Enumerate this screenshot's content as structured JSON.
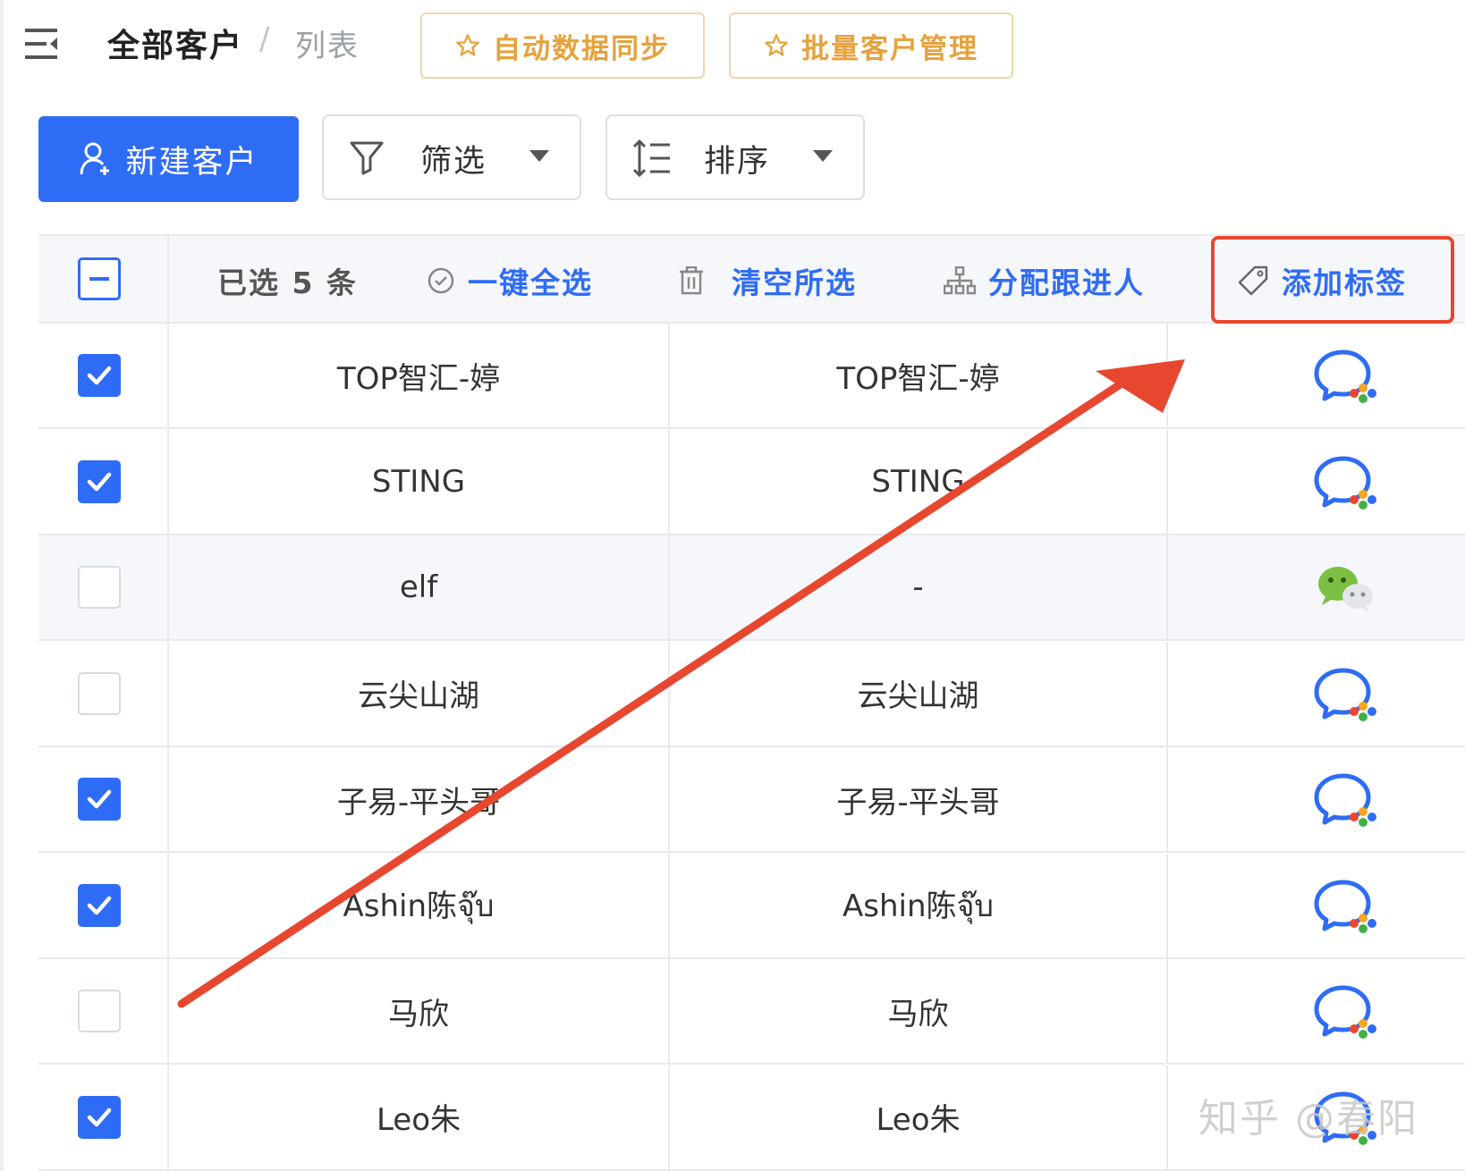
{
  "breadcrumb": {
    "main": "全部客户",
    "separator": "/",
    "sub": "列表"
  },
  "header_buttons": [
    {
      "label": "自动数据同步",
      "icon": "star-icon"
    },
    {
      "label": "批量客户管理",
      "icon": "star-icon"
    }
  ],
  "toolbar": {
    "new_label": "新建客户",
    "filter_label": "筛选",
    "sort_label": "排序"
  },
  "selection_bar": {
    "count_label": "已选 5 条",
    "select_all": "一键全选",
    "clear": "清空所选",
    "assign": "分配跟进人",
    "add_tag": "添加标签"
  },
  "rows": [
    {
      "checked": true,
      "name": "TOP智汇-婷",
      "remark": "TOP智汇-婷",
      "channel": "wecom-icon"
    },
    {
      "checked": true,
      "name": "STING",
      "remark": "STING",
      "channel": "wecom-icon"
    },
    {
      "checked": false,
      "name": "elf",
      "remark": "-",
      "channel": "wechat-icon"
    },
    {
      "checked": false,
      "name": "云尖山湖",
      "remark": "云尖山湖",
      "channel": "wecom-icon"
    },
    {
      "checked": true,
      "name": "子易-平头哥",
      "remark": "子易-平头哥",
      "channel": "wecom-icon"
    },
    {
      "checked": true,
      "name": "Ashin陈จุ๊บ",
      "remark": "Ashin陈จุ๊บ",
      "channel": "wecom-icon"
    },
    {
      "checked": false,
      "name": "马欣",
      "remark": "马欣",
      "channel": "wecom-icon"
    },
    {
      "checked": true,
      "name": "Leo朱",
      "remark": "Leo朱",
      "channel": "wecom-icon"
    }
  ],
  "watermark": "知乎 @春阳",
  "colors": {
    "primary": "#2f6cf6",
    "warning": "#e6a23c",
    "annotation": "#e8472f"
  }
}
